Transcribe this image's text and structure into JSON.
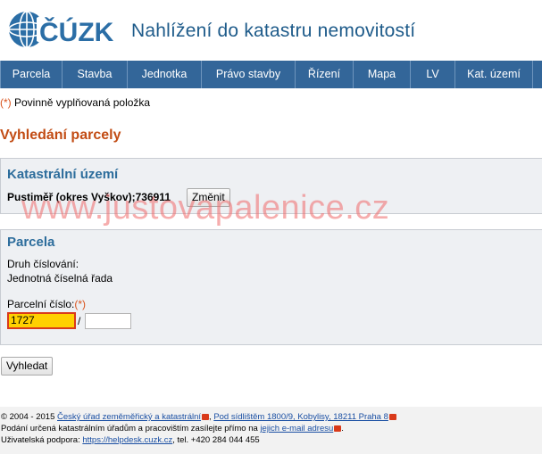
{
  "header": {
    "logo_text": "ČÚZK",
    "app_title": "Nahlížení do katastru nemovitostí"
  },
  "nav": {
    "items": [
      {
        "label": "Parcela"
      },
      {
        "label": "Stavba"
      },
      {
        "label": "Jednotka"
      },
      {
        "label": "Právo stavby"
      },
      {
        "label": "Řízení"
      },
      {
        "label": "Mapa"
      },
      {
        "label": "LV"
      },
      {
        "label": "Kat. území"
      }
    ]
  },
  "required_note": {
    "mark": "(*)",
    "text": " Povinně vyplňovaná položka"
  },
  "page_title": "Vyhledání parcely",
  "cadastral_area": {
    "title": "Katastrální území",
    "value": "Pustiměř (okres Vyškov);736911",
    "change_button": "Změnit"
  },
  "parcel": {
    "title": "Parcela",
    "numbering_label": "Druh číslování:",
    "numbering_value": "Jednotná číselná řada",
    "number_label": "Parcelní číslo:",
    "required_mark": "(*)",
    "number_value": "1727",
    "separator": "/",
    "sub_number_value": ""
  },
  "search_button": "Vyhledat",
  "watermark": "www.justovapalenice.cz",
  "footer": {
    "copyright_prefix": "© 2004 - 2015 ",
    "org_link": "Český úřad zeměměřický a katastrální",
    "address_link": "Pod sídlištěm 1800/9, Kobylisy, 18211 Praha 8",
    "line2_prefix": "Podání určená katastrálním úřadům a pracovištím zasílejte přímo na ",
    "email_link": "jejich e-mail adresu",
    "support_prefix": "Uživatelská podpora: ",
    "helpdesk_link": "https://helpdesk.cuzk.cz",
    "phone": ", tel. +420 284 044 455"
  },
  "colors": {
    "nav_bg": "#336699",
    "title_color": "#c24c14",
    "panel_title": "#2d6d9c",
    "input_highlight": "#ffd000"
  }
}
